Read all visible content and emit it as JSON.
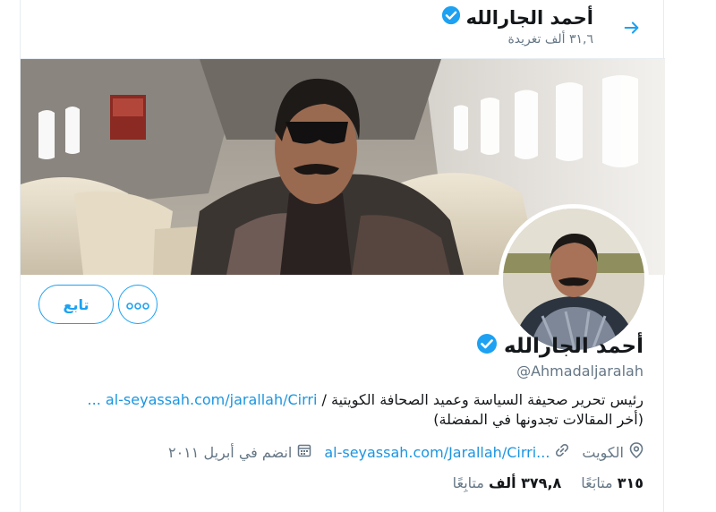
{
  "header": {
    "title": "أحمد الجارالله",
    "tweet_count": "٣١,٦ ألف تغريدة"
  },
  "actions": {
    "follow_label": "تابع",
    "more_label": "ooo"
  },
  "profile": {
    "name": "أحمد الجارالله",
    "handle": "@Ahmadaljaralah",
    "bio_text": "رئيس تحرير صحيفة السياسة وعميد الصحافة الكويتية /",
    "bio_link": "al-seyassah.com/jarallah/Cirri ...",
    "bio_line2": "(أخر المقالات تجدونها في المفضلة)",
    "location": "الكويت",
    "website": "al-seyassah.com/Jarallah/Cirri...",
    "joined": "انضم في أبريل ٢٠١١",
    "following_count": "٣١٥",
    "following_label": "متابَعًا",
    "followers_count": "٣٧٩,٨ ألف",
    "followers_label": "متابِعًا"
  },
  "colors": {
    "accent": "#1da1f2",
    "link": "#1b95e0",
    "secondary_text": "#657786"
  },
  "icons": {
    "back": "arrow-right-icon",
    "verified": "verified-badge-icon",
    "more": "more-dots-icon",
    "location": "location-pin-icon",
    "link": "link-icon",
    "calendar": "calendar-icon"
  }
}
